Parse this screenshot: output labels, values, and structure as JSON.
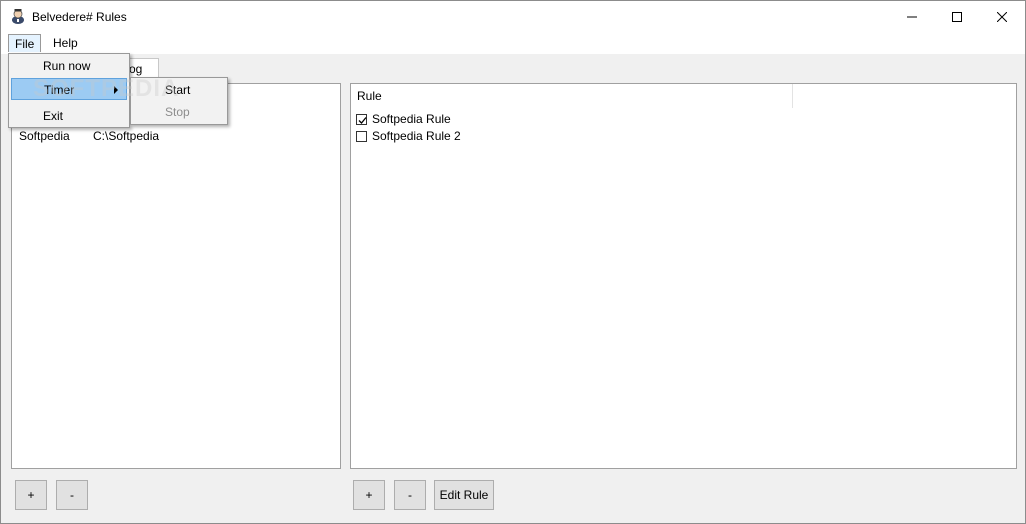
{
  "window": {
    "title": "Belvedere# Rules"
  },
  "menubar": {
    "items": [
      "File",
      "Help"
    ]
  },
  "file_menu": {
    "run_now": "Run now",
    "timer": "Timer",
    "exit": "Exit"
  },
  "timer_submenu": {
    "start": "Start",
    "stop": "Stop"
  },
  "tabs": {
    "visible_label": "og"
  },
  "folders": {
    "rows": [
      {
        "name": "Softpedia",
        "path": "C:\\Softpedia"
      }
    ]
  },
  "rules": {
    "column_header": "Rule",
    "items": [
      {
        "label": "Softpedia Rule",
        "checked": true
      },
      {
        "label": "Softpedia Rule 2",
        "checked": false
      }
    ]
  },
  "folder_buttons": {
    "add": "+",
    "remove": "-"
  },
  "rule_buttons": {
    "add": "+",
    "remove": "-",
    "edit": "Edit Rule"
  },
  "watermark": "SOFTPEDIA"
}
